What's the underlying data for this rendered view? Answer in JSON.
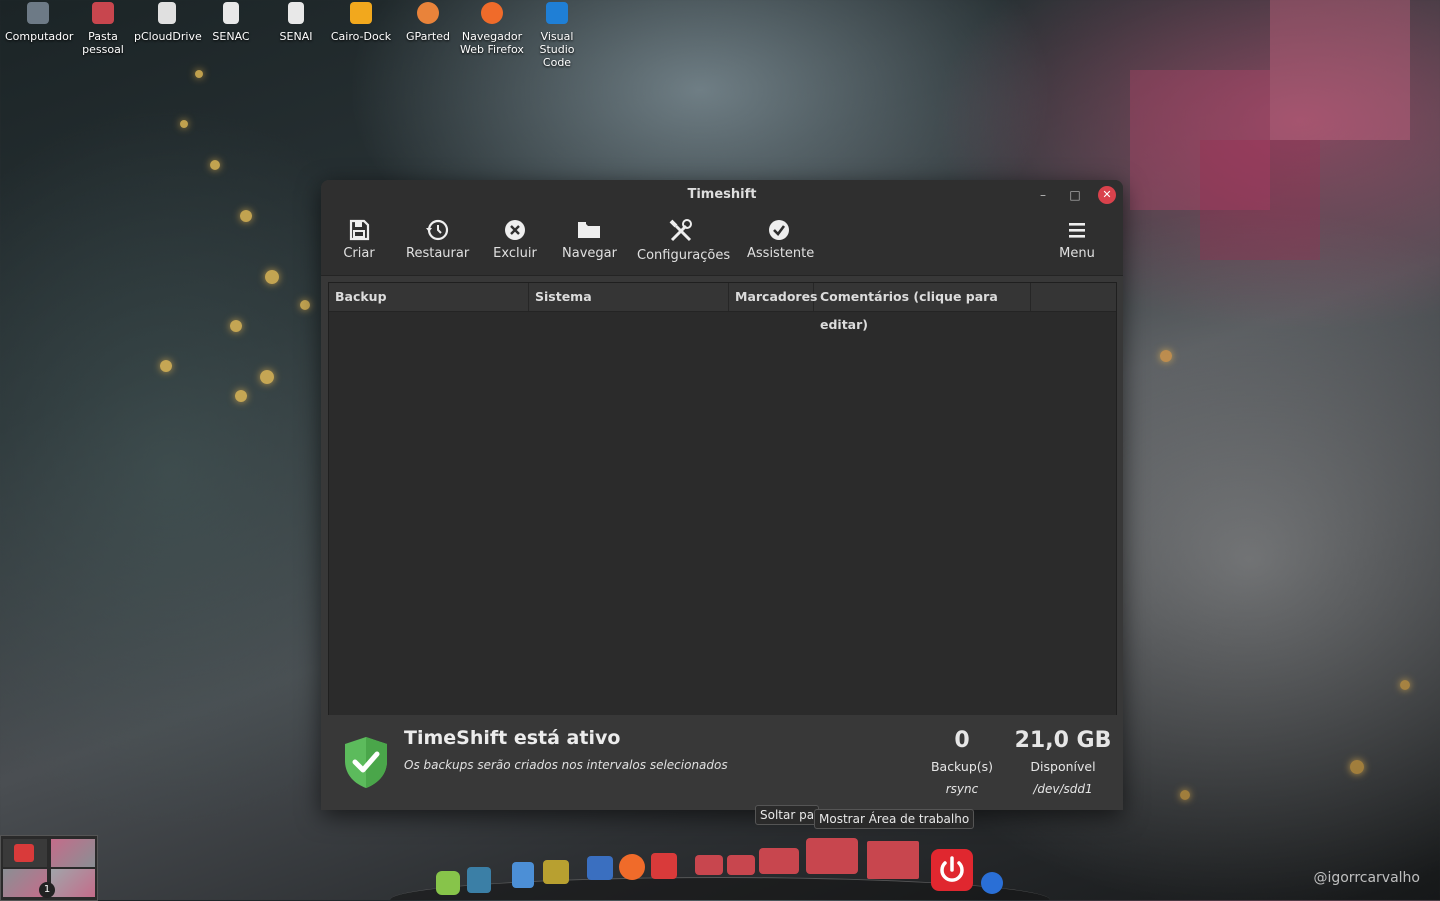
{
  "desktop": {
    "icons": [
      {
        "label": "Computador",
        "icon": "computer-icon",
        "color": "#6d7a86"
      },
      {
        "label": "Pasta\npessoal",
        "icon": "home-folder-icon",
        "color": "#c8464e"
      },
      {
        "label": "pCloudDrive",
        "icon": "drive-icon",
        "color": "#e0e0e0"
      },
      {
        "label": "SENAC",
        "icon": "file-icon",
        "color": "#e8e8e8"
      },
      {
        "label": "SENAI",
        "icon": "file-icon",
        "color": "#e8e8e8"
      },
      {
        "label": "Cairo-Dock",
        "icon": "cairo-dock-icon",
        "color": "#f2a81d"
      },
      {
        "label": "GParted",
        "icon": "gparted-icon",
        "color": "#e9833a"
      },
      {
        "label": "Navegador\nWeb Firefox",
        "icon": "firefox-icon",
        "color": "#f06b2a"
      },
      {
        "label": "Visual\nStudio Code",
        "icon": "vscode-icon",
        "color": "#1f7fd6"
      }
    ]
  },
  "window": {
    "title": "Timeshift",
    "toolbar": [
      {
        "label": "Criar",
        "icon": "save-icon"
      },
      {
        "label": "Restaurar",
        "icon": "history-icon"
      },
      {
        "label": "Excluir",
        "icon": "delete-icon"
      },
      {
        "label": "Navegar",
        "icon": "folder-icon"
      },
      {
        "label": "Configurações",
        "icon": "tools-icon"
      },
      {
        "label": "Assistente",
        "icon": "checkmark-icon"
      },
      {
        "label": "Menu",
        "icon": "hamburger-icon"
      }
    ],
    "columns": [
      "Backup",
      "Sistema",
      "Marcadores",
      "Comentários (clique para editar)"
    ],
    "rows": [],
    "status": {
      "heading": "TimeShift está ativo",
      "subtitle": "Os backups serão criados nos intervalos selecionados",
      "backups_count": "0",
      "backups_label": "Backup(s)",
      "backups_mode": "rsync",
      "available": "21,0 GB",
      "available_label": "Disponível",
      "device": "/dev/sdd1"
    }
  },
  "taskbar": {
    "tooltip_drop": "Soltar pa",
    "tooltip_show_desktop": "Mostrar Área de trabalho",
    "workspace_badge": "1"
  },
  "watermark": "@igorrcarvalho",
  "colors": {
    "accent_green": "#5cbb5c",
    "close_red": "#d9424c",
    "power_red": "#e0272f"
  }
}
